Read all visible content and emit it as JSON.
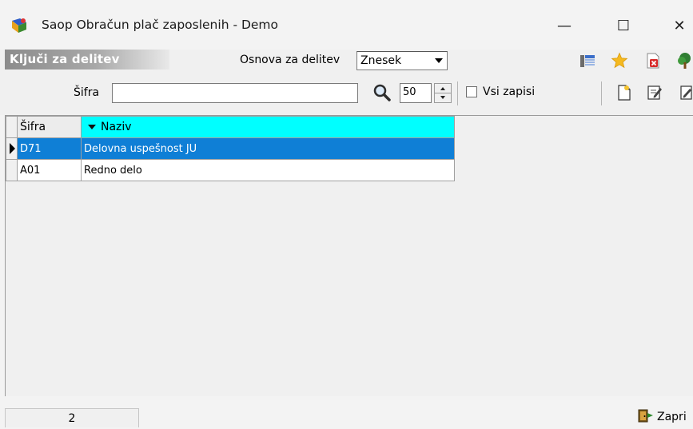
{
  "window": {
    "title": "Saop Obračun plač zaposlenih - Demo",
    "buttons": {
      "minimize": "—",
      "maximize": "☐",
      "close": "✕"
    }
  },
  "header": {
    "section_title": "Ključi za delitev",
    "osnova_label": "Osnova za delitev",
    "osnova_value": "Znesek"
  },
  "search": {
    "sifra_label": "Šifra",
    "sifra_value": "",
    "limit_value": "50",
    "vsi_zapisi_label": "Vsi zapisi",
    "vsi_zapisi_checked": false
  },
  "grid": {
    "columns": [
      "Šifra",
      "Naziv"
    ],
    "sorted_column": "Naziv",
    "rows": [
      {
        "sifra": "D71",
        "naziv": "Delovna uspešnost JU",
        "selected": true
      },
      {
        "sifra": "A01",
        "naziv": "Redno delo",
        "selected": false
      }
    ]
  },
  "status": {
    "record_count": "2",
    "close_label": "Zapri"
  },
  "colors": {
    "selected_row": "#0f7fd6",
    "sorted_header": "#00ffff",
    "section_gradient": "#8c8c8c"
  },
  "icons": [
    "app-icon",
    "columns-icon",
    "favorite-star-icon",
    "delete-record-icon",
    "tree-icon",
    "search-icon",
    "new-document-icon",
    "edit-document-icon",
    "copy-document-icon",
    "close-door-icon"
  ]
}
